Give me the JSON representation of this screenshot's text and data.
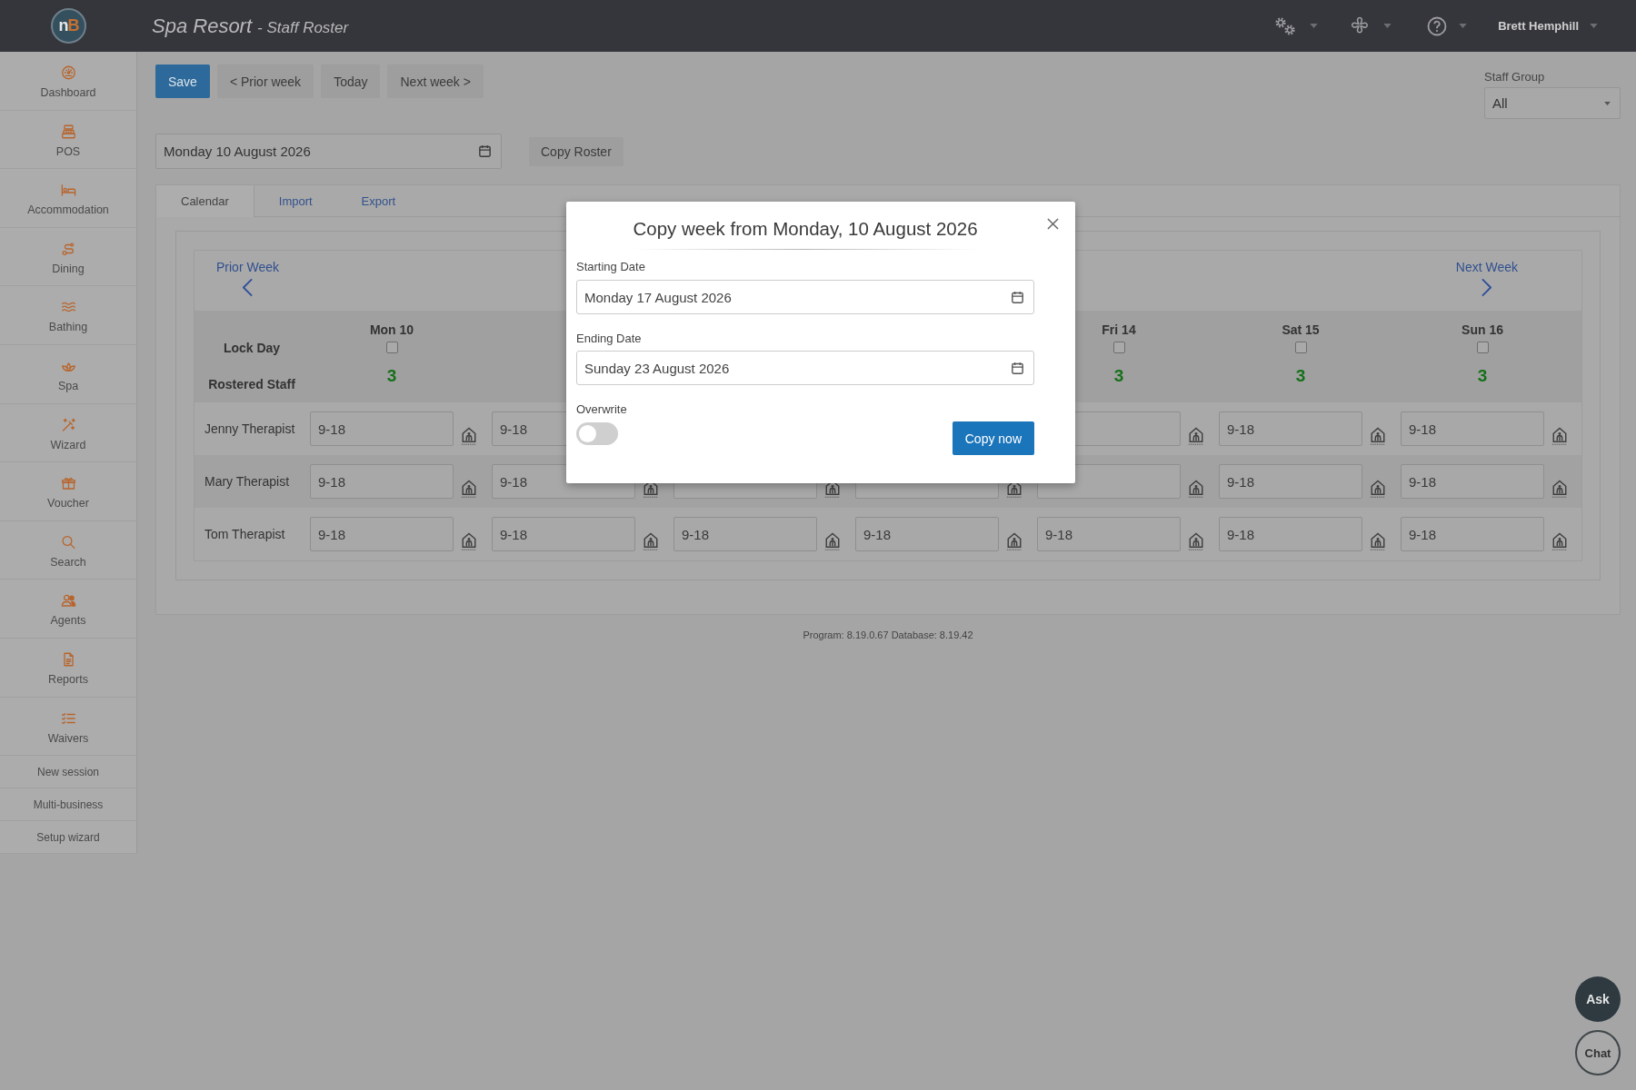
{
  "header": {
    "logo": "nB",
    "app_title": "Spa Resort",
    "page_title": "- Staff Roster",
    "user_name": "Brett Hemphill"
  },
  "sidebar": {
    "items": [
      {
        "kind": "icon",
        "label": "Dashboard"
      },
      {
        "kind": "icon",
        "label": "POS"
      },
      {
        "kind": "icon",
        "label": "Accommodation"
      },
      {
        "kind": "icon",
        "label": "Dining"
      },
      {
        "kind": "icon",
        "label": "Bathing"
      },
      {
        "kind": "icon",
        "label": "Spa"
      },
      {
        "kind": "icon",
        "label": "Wizard"
      },
      {
        "kind": "icon",
        "label": "Voucher"
      },
      {
        "kind": "icon",
        "label": "Search"
      },
      {
        "kind": "icon",
        "label": "Agents"
      },
      {
        "kind": "icon",
        "label": "Reports"
      },
      {
        "kind": "icon",
        "label": "Waivers"
      },
      {
        "kind": "text",
        "label": "New session"
      },
      {
        "kind": "text",
        "label": "Multi-business"
      },
      {
        "kind": "text",
        "label": "Setup wizard"
      }
    ]
  },
  "toolbar": {
    "buttons": [
      {
        "kind": "primary",
        "label": "Save"
      },
      {
        "kind": "default",
        "label": "< Prior week"
      },
      {
        "kind": "default",
        "label": "Today"
      },
      {
        "kind": "default",
        "label": "Next week >"
      }
    ]
  },
  "staff_group": {
    "label": "Staff Group",
    "value": "All"
  },
  "week_date": {
    "value": "Monday 10 August 2026"
  },
  "copy_roster_button": "Copy Roster",
  "tabs": [
    {
      "label": "Calendar",
      "selected": true
    },
    {
      "label": "Import",
      "selected": false
    },
    {
      "label": "Export",
      "selected": false
    }
  ],
  "roster": {
    "prior_week": "Prior Week",
    "next_week": "Next Week",
    "lock_day_label": "Lock Day",
    "rostered_label": "Rostered Staff",
    "days_left": [
      {
        "label": "Mon 10",
        "locked": false,
        "rostered": "3"
      }
    ],
    "days_right": [
      {
        "label": "Fri 14",
        "locked": false,
        "rostered": "3"
      },
      {
        "label": "Sat 15",
        "locked": false,
        "rostered": "3"
      },
      {
        "label": "Sun 16",
        "locked": false,
        "rostered": "3"
      }
    ],
    "staff": [
      {
        "name": "Jenny Therapist",
        "cells": [
          {
            "value": "9-18",
            "icon": true
          },
          {
            "value": "9-18",
            "icon": false
          },
          {},
          {},
          {
            "icon": true
          },
          {
            "value": "9-18",
            "icon": true
          },
          {
            "value": "9-18",
            "icon": true
          }
        ]
      },
      {
        "name": "Mary Therapist",
        "cells": [
          {
            "value": "9-18",
            "icon": true
          },
          {
            "value": "9-18",
            "icon": true
          },
          {
            "icon": true
          },
          {
            "icon": true
          },
          {
            "icon": true
          },
          {
            "value": "9-18",
            "icon": true
          },
          {
            "value": "9-18",
            "icon": true
          }
        ]
      },
      {
        "name": "Tom Therapist",
        "cells": [
          {
            "value": "9-18",
            "icon": true
          },
          {
            "value": "9-18",
            "icon": true
          },
          {
            "value": "9-18",
            "icon": true
          },
          {
            "value": "9-18",
            "icon": true
          },
          {
            "value": "9-18",
            "icon": true
          },
          {
            "value": "9-18",
            "icon": true
          },
          {
            "value": "9-18",
            "icon": true
          }
        ]
      }
    ]
  },
  "footer": "Program: 8.19.0.67 Database: 8.19.42",
  "modal": {
    "title": "Copy week from Monday, 10 August 2026",
    "starting_date": {
      "label": "Starting Date",
      "value": "Monday 17 August 2026"
    },
    "ending_date": {
      "label": "Ending Date",
      "value": "Sunday 23 August 2026"
    },
    "overwrite": {
      "label": "Overwrite",
      "on": false
    },
    "copy_button": "Copy now"
  },
  "help_buttons": [
    {
      "kind": "filled",
      "label": "Ask"
    },
    {
      "kind": "outline",
      "label": "Chat"
    }
  ]
}
